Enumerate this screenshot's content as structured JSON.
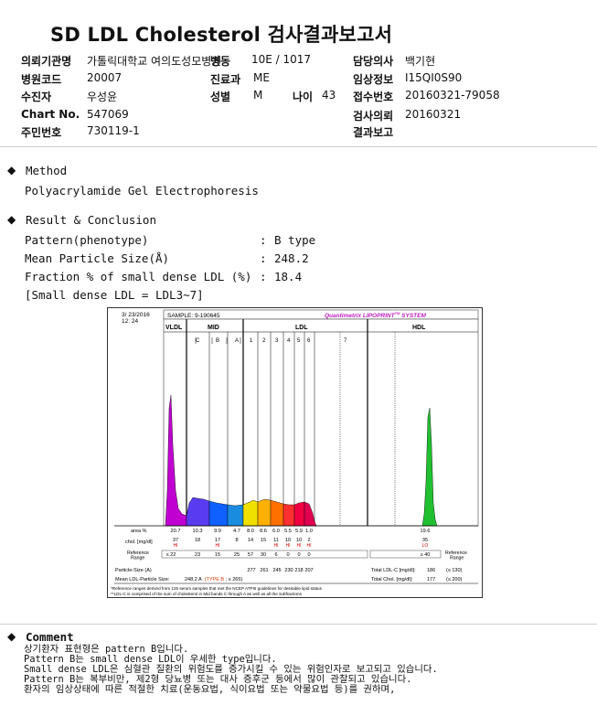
{
  "report": {
    "title": "SD LDL Cholesterol 검사결과보고서"
  },
  "header": {
    "institution": {
      "label": "의뢰기관명",
      "value": "가톨릭대학교 여의도성모병원"
    },
    "ward": {
      "label": "병동",
      "value": "10E / 1017"
    },
    "doctor": {
      "label": "담당의사",
      "value": "백기현"
    },
    "hospital_code": {
      "label": "병원코드",
      "value": "20007"
    },
    "department": {
      "label": "진료과",
      "value": "ME"
    },
    "clinical_info": {
      "label": "임상정보",
      "value": "I15QI0S90"
    },
    "patient": {
      "label": "수진자",
      "value": "우성윤"
    },
    "sex": {
      "label": "성별",
      "value": "M"
    },
    "age": {
      "label": "나이",
      "value": "43"
    },
    "receipt_no": {
      "label": "접수번호",
      "value": "20160321-79058"
    },
    "chart_no": {
      "label": "Chart No.",
      "value": "547069"
    },
    "request_date": {
      "label": "검사의뢰",
      "value": "20160321"
    },
    "resident_no": {
      "label": "주민번호",
      "value": "730119-1"
    },
    "report_date": {
      "label": "결과보고",
      "value": ""
    }
  },
  "method": {
    "bullet": "◆",
    "title": "Method",
    "text": "Polyacrylamide Gel Electrophoresis"
  },
  "result": {
    "bullet": "◆",
    "title": "Result & Conclusion",
    "rows": [
      {
        "label": "Pattern(phenotype)",
        "sep": ":",
        "value": "B type"
      },
      {
        "label": "Mean Particle Size(Å)",
        "sep": ":",
        "value": "248.2"
      },
      {
        "label": "Fraction % of small dense LDL (%)",
        "sep": ":",
        "value": "18.4"
      }
    ],
    "note": "[Small dense LDL = LDL3~7]"
  },
  "chart": {
    "date": "3/ 23/2016",
    "time": "12: 24",
    "sample": "SAMPLE:   9-190645",
    "brand": "Quantimetrix LIPOPRINT",
    "brand_sup": "TM",
    "brand_tail": " SYSTEM",
    "band_groups": [
      "VLDL",
      "MID",
      "LDL",
      "HDL"
    ],
    "mid_bands": [
      "C",
      "B",
      "A"
    ],
    "ldl_bands": [
      "1",
      "2",
      "3",
      "4",
      "5",
      "6",
      "7"
    ],
    "row_labels": {
      "area": "area %",
      "chol": "chol. [mg/dl]",
      "ref": "Reference Range",
      "hdl_ref": "Reference Range",
      "psize": "Particle-Size (A)",
      "mean": "Mean LDL-Particle Size:"
    },
    "area_values": [
      "20.7",
      "10.3",
      "9.9",
      "4.7",
      "8.0",
      "8.6",
      "6.0",
      "5.5",
      "5.9",
      "1.0",
      "19.6"
    ],
    "chol_values": [
      "37",
      "18",
      "17",
      "8",
      "14",
      "15",
      "11",
      "10",
      "10",
      "2",
      "35"
    ],
    "flags": [
      "HI",
      "",
      "HI",
      "",
      "",
      "",
      "HI",
      "HI",
      "HI",
      "HI",
      "LO"
    ],
    "ref_values": [
      "≤ 22",
      "23",
      "15",
      "25",
      "57",
      "30",
      "6",
      "0",
      "0",
      "0",
      "≥ 40"
    ],
    "particle_sizes": [
      "277",
      "261",
      "245",
      "230",
      "218",
      "207"
    ],
    "mean_size_text": "248.2 A",
    "mean_type_text": "(TYPE B",
    "mean_tail_text": " ; ≤ 265)",
    "total_ldl_label": "Total LDL-C [mg/dl]:",
    "total_ldl_value": "186",
    "total_ldl_ref": "(≤ 130)",
    "total_chol_label": "Total Chol. [mg/dl]:",
    "total_chol_value": "177",
    "total_chol_ref": "(≤ 200)",
    "footnote1": "*Reference ranges derived from 125 serum samples that met the NCEP ATPIII guidelines for desirable lipid status",
    "footnote2": "**LDL-C is comprised of the sum of cholesterol in Mid bands C through A as well as all the subfractions"
  },
  "comment": {
    "bullet": "◆",
    "title": "Comment",
    "lines": [
      "상기환자 표현형은 pattern B입니다.",
      "Pattern B는 small dense LDL이 우세한 type입니다.",
      "Small dense LDL은 심혈관 질환의 위험도를 증가시킬 수 있는 위험인자로 보고되고 있습니다.",
      "Pattern B는 복부비만, 제2형 당뇨병 또는 대사 증후군 등에서 많이 관찰되고 있습니다.",
      "환자의 임상상태에 따른 적절한 치료(운동요법, 식이요법 또는 약물요법 등)를 권하며,"
    ]
  }
}
